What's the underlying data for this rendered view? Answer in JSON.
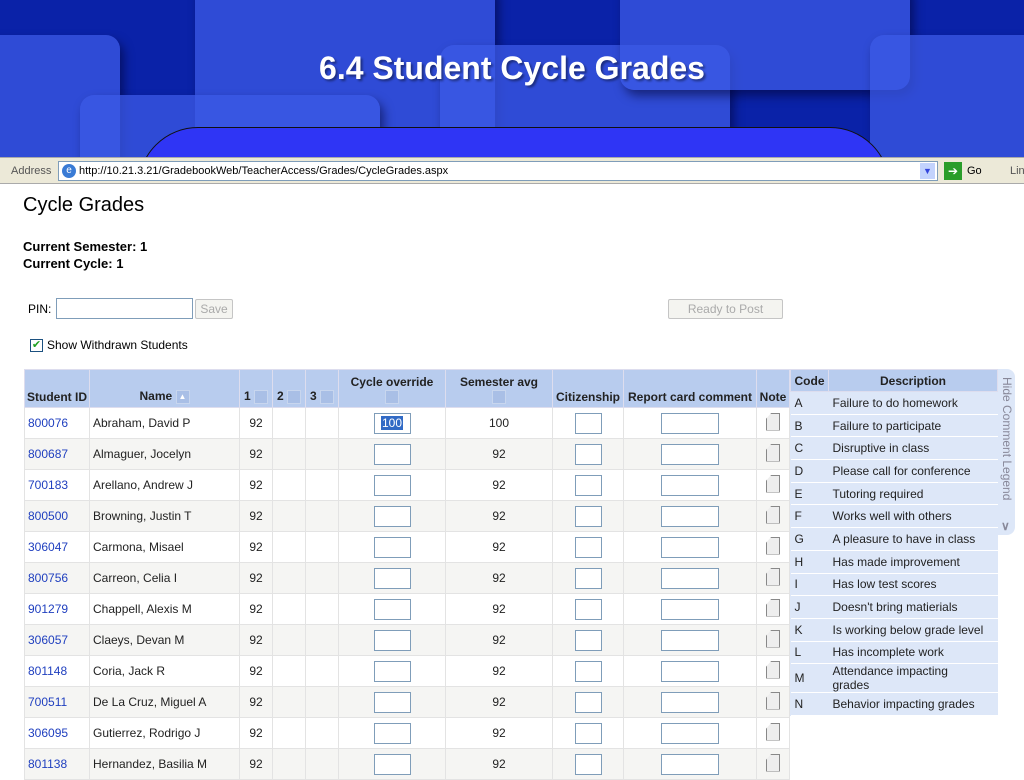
{
  "slide": {
    "title": "6.4 Student Cycle Grades"
  },
  "browser": {
    "address_label": "Address",
    "url": "http://10.21.3.21/GradebookWeb/TeacherAccess/Grades/CycleGrades.aspx",
    "go_label": "Go",
    "links_label": "Lin"
  },
  "page": {
    "title": "Cycle Grades",
    "semester": "Current Semester: 1",
    "cycle": "Current Cycle: 1",
    "pin_label": "PIN:",
    "pin_value": "",
    "save_label": "Save",
    "ready_label": "Ready to Post",
    "show_withdrawn_label": "Show Withdrawn Students",
    "show_withdrawn_checked": true
  },
  "table": {
    "headers": {
      "id": "Student ID",
      "name": "Name",
      "c1": "1",
      "c2": "2",
      "c3": "3",
      "override": "Cycle override",
      "semavg": "Semester avg",
      "citizenship": "Citizenship",
      "comment": "Report card comment",
      "note": "Note"
    },
    "rows": [
      {
        "id": "800076",
        "name": "Abraham, David P",
        "c1": "92",
        "override": "100",
        "avg": "100"
      },
      {
        "id": "800687",
        "name": "Almaguer, Jocelyn",
        "c1": "92",
        "override": "",
        "avg": "92"
      },
      {
        "id": "700183",
        "name": "Arellano, Andrew J",
        "c1": "92",
        "override": "",
        "avg": "92"
      },
      {
        "id": "800500",
        "name": "Browning, Justin T",
        "c1": "92",
        "override": "",
        "avg": "92"
      },
      {
        "id": "306047",
        "name": "Carmona, Misael",
        "c1": "92",
        "override": "",
        "avg": "92"
      },
      {
        "id": "800756",
        "name": "Carreon, Celia I",
        "c1": "92",
        "override": "",
        "avg": "92"
      },
      {
        "id": "901279",
        "name": "Chappell, Alexis M",
        "c1": "92",
        "override": "",
        "avg": "92"
      },
      {
        "id": "306057",
        "name": "Claeys, Devan M",
        "c1": "92",
        "override": "",
        "avg": "92"
      },
      {
        "id": "801148",
        "name": "Coria, Jack R",
        "c1": "92",
        "override": "",
        "avg": "92"
      },
      {
        "id": "700511",
        "name": "De La Cruz, Miguel A",
        "c1": "92",
        "override": "",
        "avg": "92"
      },
      {
        "id": "306095",
        "name": "Gutierrez, Rodrigo J",
        "c1": "92",
        "override": "",
        "avg": "92"
      },
      {
        "id": "801138",
        "name": "Hernandez, Basilia M",
        "c1": "92",
        "override": "",
        "avg": "92"
      }
    ]
  },
  "legend": {
    "code_header": "Code",
    "desc_header": "Description",
    "tab_label": "Hide Comment Legend",
    "items": [
      {
        "code": "A",
        "desc": "Failure to do homework"
      },
      {
        "code": "B",
        "desc": "Failure to participate"
      },
      {
        "code": "C",
        "desc": "Disruptive in class"
      },
      {
        "code": "D",
        "desc": "Please call for conference"
      },
      {
        "code": "E",
        "desc": "Tutoring required"
      },
      {
        "code": "F",
        "desc": "Works well with others"
      },
      {
        "code": "G",
        "desc": "A pleasure to have in class"
      },
      {
        "code": "H",
        "desc": "Has made improvement"
      },
      {
        "code": "I",
        "desc": "Has low test scores"
      },
      {
        "code": "J",
        "desc": "Doesn't bring matierials"
      },
      {
        "code": "K",
        "desc": "Is working below grade level"
      },
      {
        "code": "L",
        "desc": "Has incomplete work"
      },
      {
        "code": "M",
        "desc": "Attendance impacting grades"
      },
      {
        "code": "N",
        "desc": "Behavior impacting grades"
      }
    ]
  }
}
